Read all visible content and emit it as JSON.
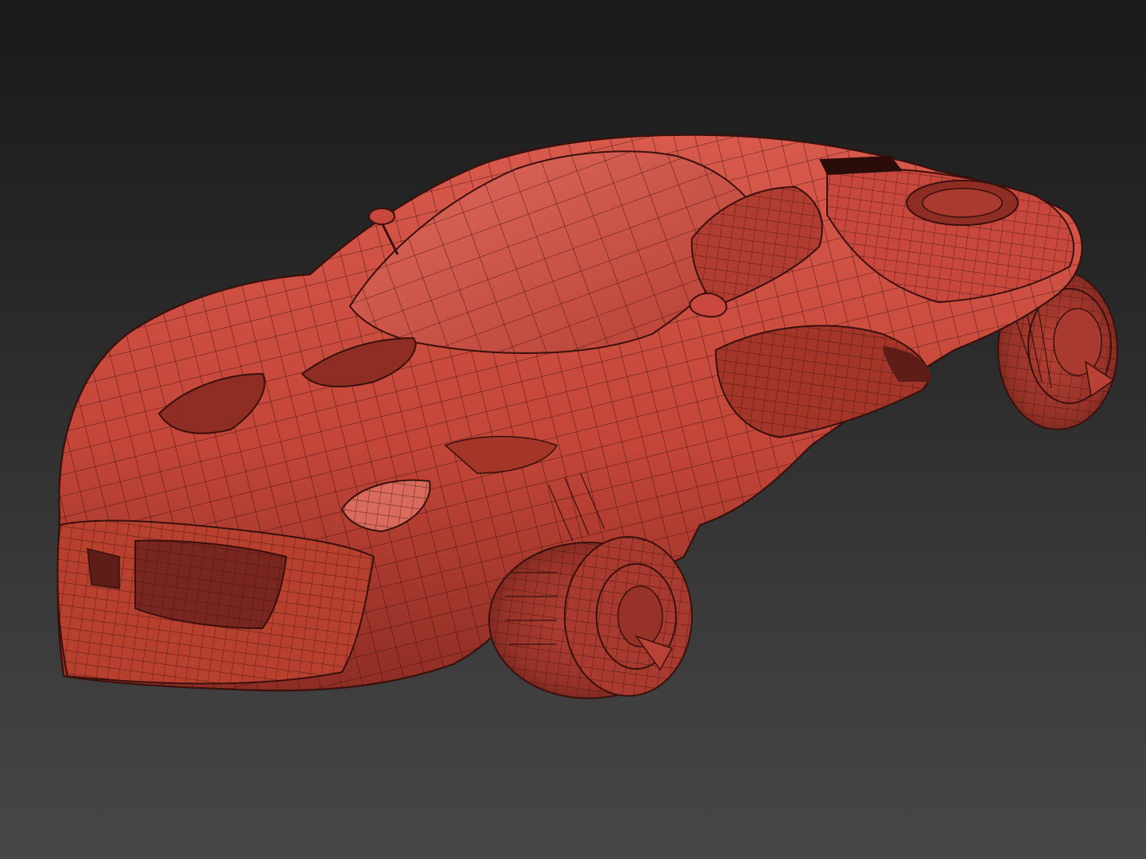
{
  "viewport": {
    "background_top": "#1a1a1a",
    "background_bottom": "#474747"
  },
  "model": {
    "kind": "wireframe car model",
    "shaded_color": "#c9483e",
    "highlight_color": "#e06a5e",
    "shadow_color": "#7a2620",
    "wire_color": "#3a100c",
    "show_wireframe": true,
    "visible_parts": [
      "body-shell",
      "windshield",
      "side-window",
      "front-bumper",
      "front-grille",
      "headlight",
      "hood-vents",
      "side-intake",
      "rear-haunch",
      "rear-vents",
      "antenna",
      "side-mirror",
      "front-wheel-hub",
      "rear-wheel-hub"
    ]
  }
}
